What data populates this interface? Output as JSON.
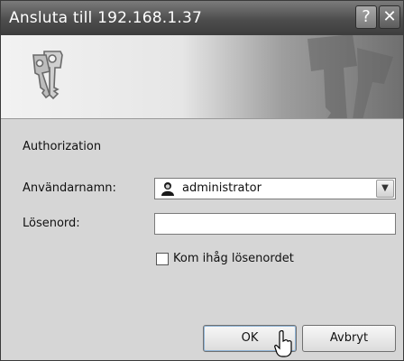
{
  "window": {
    "title": "Ansluta till 192.168.1.37",
    "help_label": "?",
    "close_label": "✕"
  },
  "banner": {
    "icon": "keys-icon"
  },
  "form": {
    "realm": "Authorization",
    "username_label": "Användarnamn:",
    "username_value": "administrator",
    "password_label": "Lösenord:",
    "password_value": "",
    "remember_label": "Kom ihåg lösenordet",
    "remember_checked": false
  },
  "buttons": {
    "ok_label": "OK",
    "cancel_label": "Avbryt"
  }
}
